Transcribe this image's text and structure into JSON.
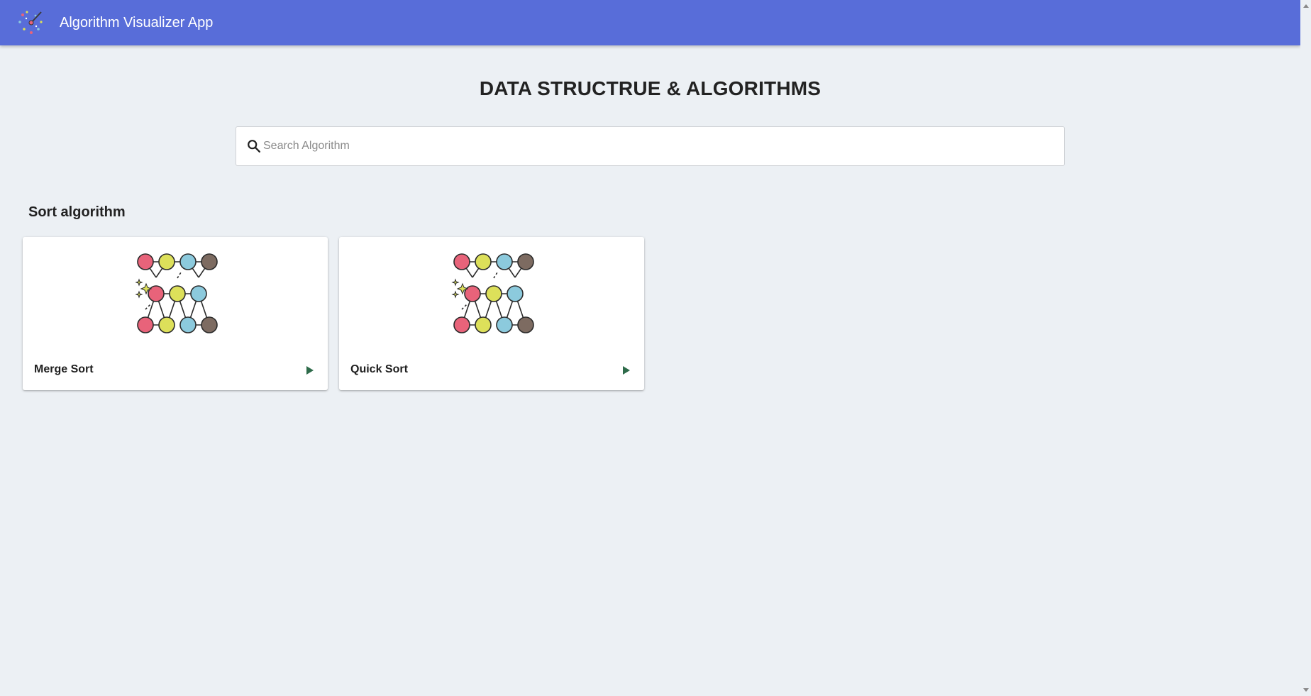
{
  "app": {
    "title": "Algorithm Visualizer App",
    "accent_color": "#586dd9"
  },
  "main": {
    "heading": "DATA STRUCTRUE & ALGORITHMS",
    "search": {
      "placeholder": "Search Algorithm",
      "value": "",
      "icon": "search-icon"
    },
    "sections": [
      {
        "title": "Sort algorithm",
        "cards": [
          {
            "label": "Merge Sort",
            "icon": "sort-network-illustration",
            "action_icon": "play-icon"
          },
          {
            "label": "Quick Sort",
            "icon": "sort-network-illustration",
            "action_icon": "play-icon"
          }
        ]
      }
    ]
  },
  "colors": {
    "node_red": "#e8637a",
    "node_yellow": "#dde05a",
    "node_blue": "#8ccadd",
    "node_brown": "#7d6b61",
    "play_green": "#2e6b4a"
  }
}
